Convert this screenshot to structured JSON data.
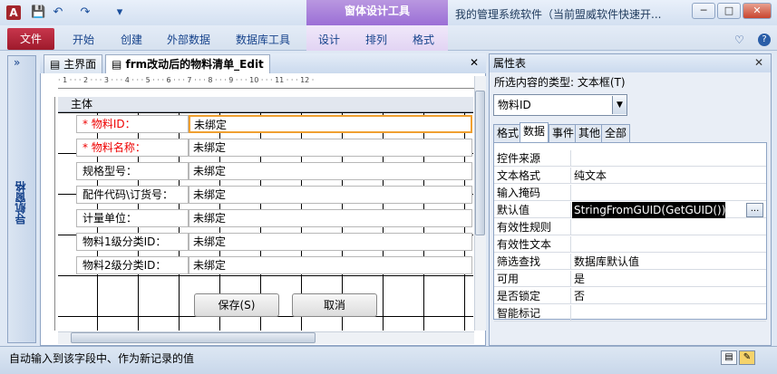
{
  "titlebar": {
    "app_icon": "A",
    "context_group": "窗体设计工具",
    "window_title": "我的管理系统软件（当前盟威软件快速开...",
    "min": "─",
    "max": "□",
    "close": "✕"
  },
  "qat": {
    "save": "💾",
    "undo": "↶",
    "redo": "↷",
    "customize": "▾"
  },
  "ribbon": {
    "file": "文件",
    "tabs": [
      "开始",
      "创建",
      "外部数据",
      "数据库工具",
      "设计",
      "排列",
      "格式"
    ],
    "help": "?",
    "minimize": "♡"
  },
  "nav": {
    "toggle": "»",
    "label": "导航窗格"
  },
  "doc": {
    "tabs": [
      "主界面",
      "frm改动后的物料清单_Edit"
    ],
    "close": "✕",
    "ruler": "· 1 · · · 2 · · · 3 · · · 4 · · · 5 · · · 6 · · · 7 · · · 8 · · · 9 · · · 10 · · · 11 · · · 12 ·",
    "section": "主体",
    "fields": [
      {
        "label": "* 物料ID：",
        "value": "未绑定",
        "req": true
      },
      {
        "label": "* 物料名称：",
        "value": "未绑定",
        "req": true
      },
      {
        "label": "规格型号：",
        "value": "未绑定"
      },
      {
        "label": "配件代码\\订货号：",
        "value": "未绑定"
      },
      {
        "label": "计量单位：",
        "value": "未绑定"
      },
      {
        "label": "物料1级分类ID：",
        "value": "未绑定"
      },
      {
        "label": "物料2级分类ID：",
        "value": "未绑定"
      }
    ],
    "save_btn": "保存(S)",
    "cancel_btn": "取消"
  },
  "prop": {
    "title": "属性表",
    "close": "✕",
    "type_line": "所选内容的类型: 文本框(T)",
    "selected": "物料ID",
    "tabs": [
      "格式",
      "数据",
      "事件",
      "其他",
      "全部"
    ],
    "rows": [
      {
        "name": "控件来源",
        "value": ""
      },
      {
        "name": "文本格式",
        "value": "纯文本"
      },
      {
        "name": "输入掩码",
        "value": ""
      },
      {
        "name": "默认值",
        "value": "StringFromGUID(GetGUID())"
      },
      {
        "name": "有效性规则",
        "value": ""
      },
      {
        "name": "有效性文本",
        "value": ""
      },
      {
        "name": "筛选查找",
        "value": "数据库默认值"
      },
      {
        "name": "可用",
        "value": "是"
      },
      {
        "name": "是否锁定",
        "value": "否"
      },
      {
        "name": "智能标记",
        "value": ""
      }
    ],
    "build": "..."
  },
  "status": {
    "text": "自动输入到该字段中、作为新记录的值"
  },
  "colors": {
    "accent": "#a4262c",
    "context": "#9b6fd6"
  }
}
